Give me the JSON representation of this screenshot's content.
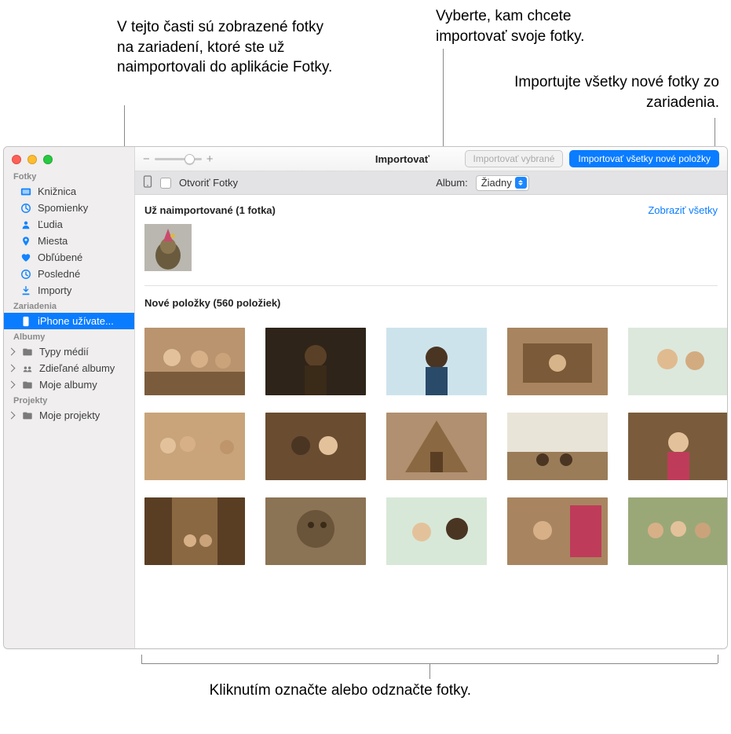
{
  "callouts": {
    "top_left": "V tejto časti sú zobrazené fotky na zariadení, ktoré ste už naimportovali do aplikácie Fotky.",
    "top_right1": "Vyberte, kam chcete importovať svoje fotky.",
    "top_right2": "Importujte všetky nové fotky zo zariadenia.",
    "bottom": "Kliknutím označte alebo odznačte fotky."
  },
  "sidebar": {
    "sections": {
      "photos": "Fotky",
      "devices": "Zariadenia",
      "albums": "Albumy",
      "projects": "Projekty"
    },
    "items": {
      "library": "Knižnica",
      "memories": "Spomienky",
      "people": "Ľudia",
      "places": "Miesta",
      "favorites": "Obľúbené",
      "recent": "Posledné",
      "imports": "Importy",
      "device": "iPhone užívate...",
      "media_types": "Typy médií",
      "shared_albums": "Zdieľané albumy",
      "my_albums": "Moje albumy",
      "my_projects": "Moje projekty"
    }
  },
  "toolbar": {
    "title": "Importovať",
    "import_selected": "Importovať vybrané",
    "import_all_new": "Importovať všetky nové položky",
    "zoom_minus": "−",
    "zoom_plus": "+"
  },
  "subbar": {
    "open_photos": "Otvoriť Fotky",
    "album_label": "Album:",
    "album_value": "Žiadny"
  },
  "sections": {
    "already_imported": "Už naimportované (1 fotka)",
    "show_all": "Zobraziť všetky",
    "new_items": "Nové položky (560 položiek)"
  }
}
